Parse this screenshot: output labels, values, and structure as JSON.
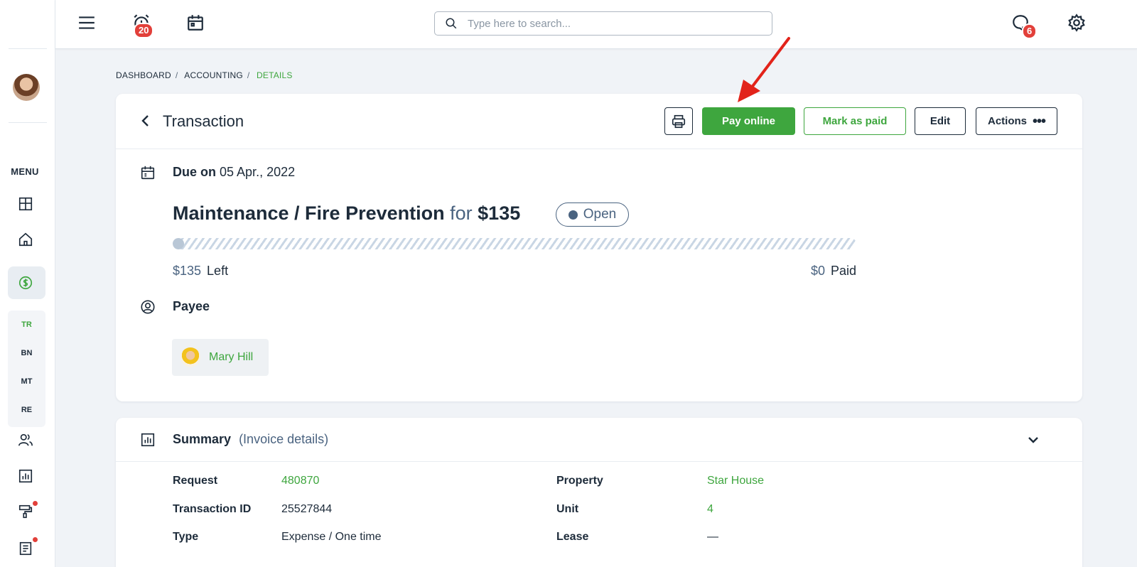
{
  "topbar": {
    "notifications_count": "20",
    "messages_count": "6",
    "search_placeholder": "Type here to search..."
  },
  "sidebar": {
    "menu_label": "MENU",
    "submenu": [
      "TR",
      "BN",
      "MT",
      "RE"
    ]
  },
  "breadcrumb": {
    "items": [
      "DASHBOARD",
      "ACCOUNTING",
      "DETAILS"
    ]
  },
  "transaction": {
    "title": "Transaction",
    "buttons": {
      "pay_online": "Pay online",
      "mark_as_paid": "Mark as paid",
      "edit": "Edit",
      "actions": "Actions"
    },
    "due_label": "Due on",
    "due_date": "05 Apr., 2022",
    "name": "Maintenance / Fire Prevention",
    "for_word": "for",
    "amount": "$135",
    "status": "Open",
    "progress_paid_fraction": 0,
    "left_amount": "$135",
    "left_label": "Left",
    "paid_amount": "$0",
    "paid_label": "Paid",
    "payee_label": "Payee",
    "payee_name": "Mary Hill"
  },
  "summary": {
    "title": "Summary",
    "subtitle": "(Invoice details)",
    "left_fields": [
      {
        "label": "Request",
        "value": "480870"
      },
      {
        "label": "Transaction ID",
        "value": "25527844"
      },
      {
        "label": "Type",
        "value": "Expense / One time"
      }
    ],
    "right_fields": [
      {
        "label": "Property",
        "value": "Star House"
      },
      {
        "label": "Unit",
        "value": "4"
      },
      {
        "label": "Lease",
        "value": "—"
      }
    ]
  },
  "colors": {
    "accent_green": "#3ea63e",
    "badge_red": "#e2403a",
    "annotation_arrow": "#e2231a"
  }
}
